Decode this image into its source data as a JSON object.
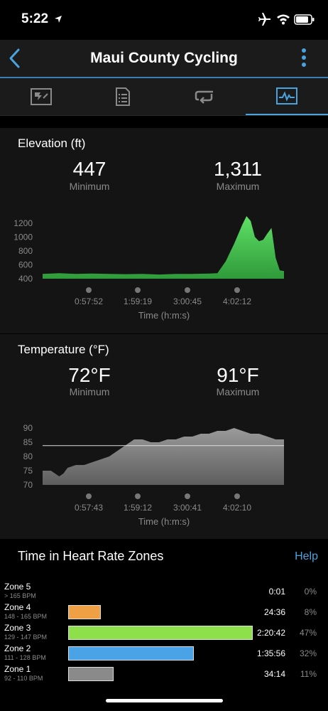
{
  "status_bar": {
    "time": "5:22"
  },
  "nav": {
    "title": "Maui County Cycling"
  },
  "tabs": [
    "summary-tab",
    "details-tab",
    "laps-tab",
    "charts-tab"
  ],
  "colors": {
    "accent": "#4aa3df",
    "elevation_fill": "#4ecb56",
    "temperature_fill": "#777777",
    "zone5": "#888888",
    "zone4": "#f0a044",
    "zone3": "#8ee04a",
    "zone2": "#4aa3e6",
    "zone1": "#8a8a8a"
  },
  "elevation": {
    "title": "Elevation (ft)",
    "min_value": "447",
    "min_label": "Minimum",
    "max_value": "1,311",
    "max_label": "Maximum",
    "xlabel": "Time (h:m:s)"
  },
  "temperature": {
    "title": "Temperature (°F)",
    "min_value": "72°F",
    "min_label": "Minimum",
    "max_value": "91°F",
    "max_label": "Maximum",
    "xlabel": "Time (h:m:s)"
  },
  "chart_data": [
    {
      "type": "area",
      "title": "Elevation (ft)",
      "xlabel": "Time (h:m:s)",
      "ylabel": "",
      "ylim": [
        400,
        1300
      ],
      "yticks": [
        400,
        600,
        800,
        1000,
        1200
      ],
      "xticks": [
        "0:57:52",
        "1:59:19",
        "3:00:45",
        "4:02:12"
      ],
      "x_minutes": [
        0,
        20,
        40,
        60,
        80,
        100,
        120,
        140,
        160,
        180,
        200,
        210,
        220,
        230,
        240,
        245,
        250,
        255,
        260,
        265,
        270,
        275,
        280,
        285,
        290
      ],
      "values": [
        470,
        480,
        470,
        475,
        470,
        465,
        470,
        460,
        470,
        470,
        475,
        480,
        650,
        900,
        1180,
        1300,
        1230,
        1000,
        940,
        960,
        1050,
        1130,
        700,
        520,
        510
      ]
    },
    {
      "type": "area",
      "title": "Temperature (°F)",
      "xlabel": "Time (h:m:s)",
      "ylabel": "",
      "ylim": [
        70,
        92
      ],
      "yticks": [
        70,
        75,
        80,
        85,
        90
      ],
      "xticks": [
        "0:57:43",
        "1:59:12",
        "3:00:41",
        "4:02:10"
      ],
      "reference_line": 83.8,
      "x_minutes": [
        0,
        10,
        20,
        25,
        30,
        40,
        50,
        60,
        70,
        80,
        90,
        100,
        110,
        120,
        130,
        140,
        150,
        160,
        170,
        180,
        190,
        200,
        210,
        220,
        230,
        240,
        250,
        260,
        270,
        280,
        290
      ],
      "values": [
        75,
        75,
        73,
        74,
        76,
        77,
        77,
        78,
        79,
        80,
        82,
        84,
        86,
        86,
        85,
        85,
        86,
        86,
        87,
        87,
        88,
        88,
        89,
        89,
        90,
        89,
        88,
        88,
        87,
        86,
        86
      ]
    }
  ],
  "heart_rate": {
    "title": "Time in Heart Rate Zones",
    "help_label": "Help",
    "zones": [
      {
        "name": "Zone 5",
        "range": "> 165 BPM",
        "time": "0:01",
        "pct": "0%",
        "fraction": 0.0
      },
      {
        "name": "Zone 4",
        "range": "148 - 165 BPM",
        "time": "24:36",
        "pct": "8%",
        "fraction": 0.17
      },
      {
        "name": "Zone 3",
        "range": "129 - 147 BPM",
        "time": "2:20:42",
        "pct": "47%",
        "fraction": 1.0
      },
      {
        "name": "Zone 2",
        "range": "111 - 128 BPM",
        "time": "1:35:56",
        "pct": "32%",
        "fraction": 0.68
      },
      {
        "name": "Zone 1",
        "range": "92 - 110 BPM",
        "time": "34:14",
        "pct": "11%",
        "fraction": 0.24
      }
    ]
  }
}
